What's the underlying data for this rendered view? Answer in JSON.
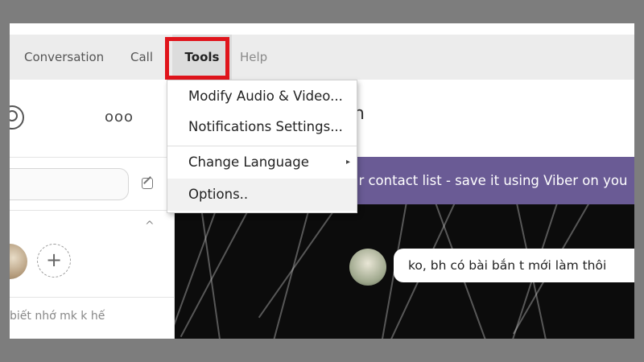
{
  "menubar": {
    "items": [
      "Conversation",
      "Call",
      "Tools",
      "Help"
    ]
  },
  "tools_menu": {
    "items": [
      {
        "label": "Modify Audio & Video..."
      },
      {
        "label": "Notifications Settings..."
      },
      {
        "label": "Change Language",
        "submenu_arrow": "▸"
      },
      {
        "label": "Options.."
      }
    ]
  },
  "sidebar": {
    "more_icon": "ooo",
    "collapse_icon": "^",
    "add_story_icon": "+",
    "chat_preview": "biết nhớ mk k hế"
  },
  "chat": {
    "header_title_fragment": "n",
    "banner_text": "ur contact list - save it using Viber on you",
    "message_text": "ko, bh có bài bắn t mới làm thôi"
  },
  "colors": {
    "highlight": "#e0141b",
    "banner": "#6a5b95",
    "chat_background": "#0c0c0c"
  },
  "icons": [
    "user-icon",
    "more-icon",
    "compose-icon",
    "collapse-icon",
    "add-story-icon",
    "submenu-arrow-icon"
  ]
}
